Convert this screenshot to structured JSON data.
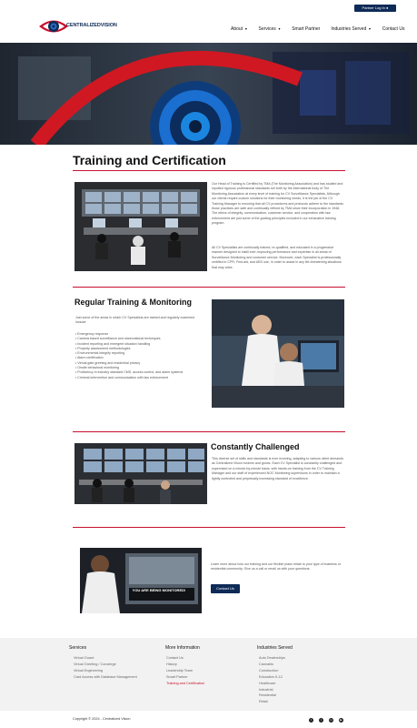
{
  "header": {
    "login_label": "Partner Log In",
    "logo_text": "CENTRALIZEDVISION",
    "nav": [
      {
        "label": "About",
        "dropdown": true
      },
      {
        "label": "Services",
        "dropdown": true
      },
      {
        "label": "Smart Partner",
        "dropdown": false
      },
      {
        "label": "Industries Served",
        "dropdown": true
      },
      {
        "label": "Contact Us",
        "dropdown": false
      }
    ]
  },
  "main": {
    "title": "Training and Certification",
    "intro_p1": "Our Head of Training is Certified by TMA (The Monitoring Association) and has studied and inputted rigorous professional standards set forth by the international body of The Monitoring Association at every level of training for CV Surveillance Specialists. Although our clients require custom solutions for their monitoring needs, it is the job of the CV Training Manager to ensuring that all CV procedures and protocols adhere to the standards those practices are safe and continually refined by TMA since their incorporation in 1948. The ethics of integrity, communication, customer service, and cooperation with law enforcement are just some of the guiding principles included in our exhaustive training program.",
    "intro_p2": "All CV Specialists are continually trained, re-qualified, and educated in a progressive manner designed to instill ever-improving performance and expertise in all areas of Surveillance Monitoring and customer service. Moreover, each Specialist is professionally certified in CPR, First-aid, and AED use, in order to assist in any life-threatening situations that may arise.",
    "regular_title": "Regular Training & Monitoring",
    "regular_intro": "Just some of the areas in which CV Specialists are trained and regularly examined include:",
    "regular_list": [
      "Emergency response",
      "Camera based surveillance and observational techniques",
      "Incident reporting and emergent situation handling",
      "Property assessment methodologies",
      "Environmental integrity reporting",
      "Alarm certification",
      "Virtual gate greeting and residential privacy",
      "Onsite behavioral monitoring",
      "Proficiency in industry standard CMS, access control, and alarm systems",
      "Criminal intervention and communication with law enforcement"
    ],
    "challenged_title": "Constantly Challenged",
    "challenged_text": "This diverse set of skills and standards is ever evolving, adapting to various client demands as Centralized Vision evolves and grows. Each CV Specialist is constantly challenged and supervised on a minute-by-minute basis, with hands-on training from the CV Training Manager and our staff of experienced NOC Monitoring supervisors in order to maintain a tightly controlled and perpetually increasing standard of excellence.",
    "cta_text": "Learn more about how our training and our flexible plans relate to your type of business or residential community. Give us a call or email us with your questions.",
    "cta_button": "Contact Us",
    "monitor_caption": "YOU ARE BEING MONITORED!"
  },
  "footer": {
    "services_title": "Services",
    "services": [
      "Virtual Guard",
      "Virtual Greeting / Concierge",
      "Virtual Engineering",
      "Card Access with Database Management"
    ],
    "info_title": "More Information",
    "info": [
      "Contact Us",
      "History",
      "Leadership Team",
      "Smart Partner",
      "Training and Certification"
    ],
    "industries_title": "Industries Served",
    "industries": [
      "Auto Dealerships",
      "Cannabis",
      "Construction",
      "Education K-12",
      "Healthcare",
      "Industrial",
      "Residential",
      "Retail"
    ],
    "copyright": "Copyright © 2024 - Centralized Vision",
    "socials": [
      "facebook-icon",
      "twitter-icon",
      "linkedin-icon",
      "youtube-icon"
    ]
  },
  "colors": {
    "navy": "#0e2a57",
    "red": "#c8102e"
  }
}
